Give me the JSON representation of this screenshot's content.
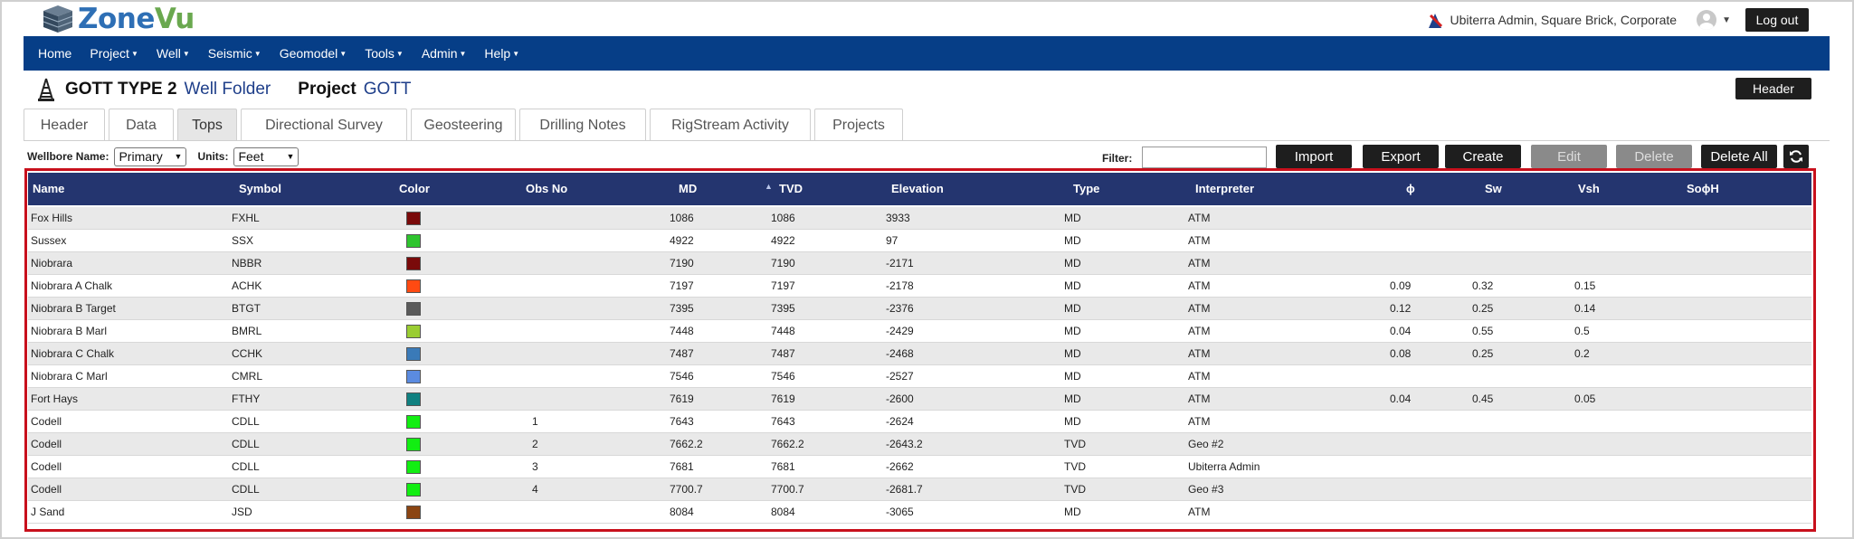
{
  "app": {
    "brand_a": "Zone",
    "brand_b": "Vu"
  },
  "user": {
    "name": "Ubiterra Admin, Square Brick, Corporate",
    "logout_label": "Log out"
  },
  "nav": [
    "Home",
    "Project",
    "Well",
    "Seismic",
    "Geomodel",
    "Tools",
    "Admin",
    "Help"
  ],
  "nav_has_menu": [
    false,
    true,
    true,
    true,
    true,
    true,
    true,
    true
  ],
  "title": {
    "well_name": "GOTT TYPE 2",
    "well_type": "Well Folder",
    "project_label": "Project",
    "project_name": "GOTT",
    "header_button": "Header"
  },
  "tabs": [
    "Header",
    "Data",
    "Tops",
    "Directional Survey",
    "Geosteering",
    "Drilling Notes",
    "RigStream Activity",
    "Projects"
  ],
  "active_tab": "Tops",
  "toolbar": {
    "wellbore_label": "Wellbore Name:",
    "wellbore_value": "Primary",
    "units_label": "Units:",
    "units_value": "Feet",
    "filter_label": "Filter:",
    "filter_value": "",
    "buttons": [
      "Import",
      "Export",
      "Create",
      "Edit",
      "Delete",
      "Delete All"
    ],
    "disabled_buttons": [
      "Edit",
      "Delete"
    ]
  },
  "table": {
    "columns": [
      "Name",
      "Symbol",
      "Color",
      "Obs No",
      "MD",
      "TVD",
      "Elevation",
      "Type",
      "Interpreter",
      "ϕ",
      "Sw",
      "Vsh",
      "SoϕH"
    ],
    "sorted_column": "TVD",
    "rows": [
      {
        "name": "Fox Hills",
        "symbol": "FXHL",
        "color": "#7a0a0a",
        "obs": "",
        "md": "1086",
        "tvd": "1086",
        "elev": "3933",
        "type": "MD",
        "interp": "ATM",
        "phi": "",
        "sw": "",
        "vsh": "",
        "so": ""
      },
      {
        "name": "Sussex",
        "symbol": "SSX",
        "color": "#2ec42e",
        "obs": "",
        "md": "4922",
        "tvd": "4922",
        "elev": "97",
        "type": "MD",
        "interp": "ATM",
        "phi": "",
        "sw": "",
        "vsh": "",
        "so": ""
      },
      {
        "name": "Niobrara",
        "symbol": "NBBR",
        "color": "#7a0a0a",
        "obs": "",
        "md": "7190",
        "tvd": "7190",
        "elev": "-2171",
        "type": "MD",
        "interp": "ATM",
        "phi": "",
        "sw": "",
        "vsh": "",
        "so": ""
      },
      {
        "name": "Niobrara A Chalk",
        "symbol": "ACHK",
        "color": "#ff4a12",
        "obs": "",
        "md": "7197",
        "tvd": "7197",
        "elev": "-2178",
        "type": "MD",
        "interp": "ATM",
        "phi": "0.09",
        "sw": "0.32",
        "vsh": "0.15",
        "so": ""
      },
      {
        "name": "Niobrara B Target",
        "symbol": "BTGT",
        "color": "#5a5a5a",
        "obs": "",
        "md": "7395",
        "tvd": "7395",
        "elev": "-2376",
        "type": "MD",
        "interp": "ATM",
        "phi": "0.12",
        "sw": "0.25",
        "vsh": "0.14",
        "so": ""
      },
      {
        "name": "Niobrara B Marl",
        "symbol": "BMRL",
        "color": "#9acd32",
        "obs": "",
        "md": "7448",
        "tvd": "7448",
        "elev": "-2429",
        "type": "MD",
        "interp": "ATM",
        "phi": "0.04",
        "sw": "0.55",
        "vsh": "0.5",
        "so": ""
      },
      {
        "name": "Niobrara C Chalk",
        "symbol": "CCHK",
        "color": "#3a7ab8",
        "obs": "",
        "md": "7487",
        "tvd": "7487",
        "elev": "-2468",
        "type": "MD",
        "interp": "ATM",
        "phi": "0.08",
        "sw": "0.25",
        "vsh": "0.2",
        "so": ""
      },
      {
        "name": "Niobrara C Marl",
        "symbol": "CMRL",
        "color": "#5b8be0",
        "obs": "",
        "md": "7546",
        "tvd": "7546",
        "elev": "-2527",
        "type": "MD",
        "interp": "ATM",
        "phi": "",
        "sw": "",
        "vsh": "",
        "so": ""
      },
      {
        "name": "Fort Hays",
        "symbol": "FTHY",
        "color": "#0f8080",
        "obs": "",
        "md": "7619",
        "tvd": "7619",
        "elev": "-2600",
        "type": "MD",
        "interp": "ATM",
        "phi": "0.04",
        "sw": "0.45",
        "vsh": "0.05",
        "so": ""
      },
      {
        "name": "Codell",
        "symbol": "CDLL",
        "color": "#12ee12",
        "obs": "1",
        "md": "7643",
        "tvd": "7643",
        "elev": "-2624",
        "type": "MD",
        "interp": "ATM",
        "phi": "",
        "sw": "",
        "vsh": "",
        "so": ""
      },
      {
        "name": "Codell",
        "symbol": "CDLL",
        "color": "#12ee12",
        "obs": "2",
        "md": "7662.2",
        "tvd": "7662.2",
        "elev": "-2643.2",
        "type": "TVD",
        "interp": "Geo #2",
        "phi": "",
        "sw": "",
        "vsh": "",
        "so": ""
      },
      {
        "name": "Codell",
        "symbol": "CDLL",
        "color": "#12ee12",
        "obs": "3",
        "md": "7681",
        "tvd": "7681",
        "elev": "-2662",
        "type": "TVD",
        "interp": "Ubiterra Admin",
        "phi": "",
        "sw": "",
        "vsh": "",
        "so": ""
      },
      {
        "name": "Codell",
        "symbol": "CDLL",
        "color": "#12ee12",
        "obs": "4",
        "md": "7700.7",
        "tvd": "7700.7",
        "elev": "-2681.7",
        "type": "TVD",
        "interp": "Geo #3",
        "phi": "",
        "sw": "",
        "vsh": "",
        "so": ""
      },
      {
        "name": "J Sand",
        "symbol": "JSD",
        "color": "#8b4513",
        "obs": "",
        "md": "8084",
        "tvd": "8084",
        "elev": "-3065",
        "type": "MD",
        "interp": "ATM",
        "phi": "",
        "sw": "",
        "vsh": "",
        "so": ""
      }
    ]
  },
  "colors": {
    "nav_bg": "#063e87",
    "table_header_bg": "#24356f",
    "highlight_border": "#c8101c",
    "brand_blue": "#2e6fb5",
    "brand_green": "#6aa84f"
  }
}
